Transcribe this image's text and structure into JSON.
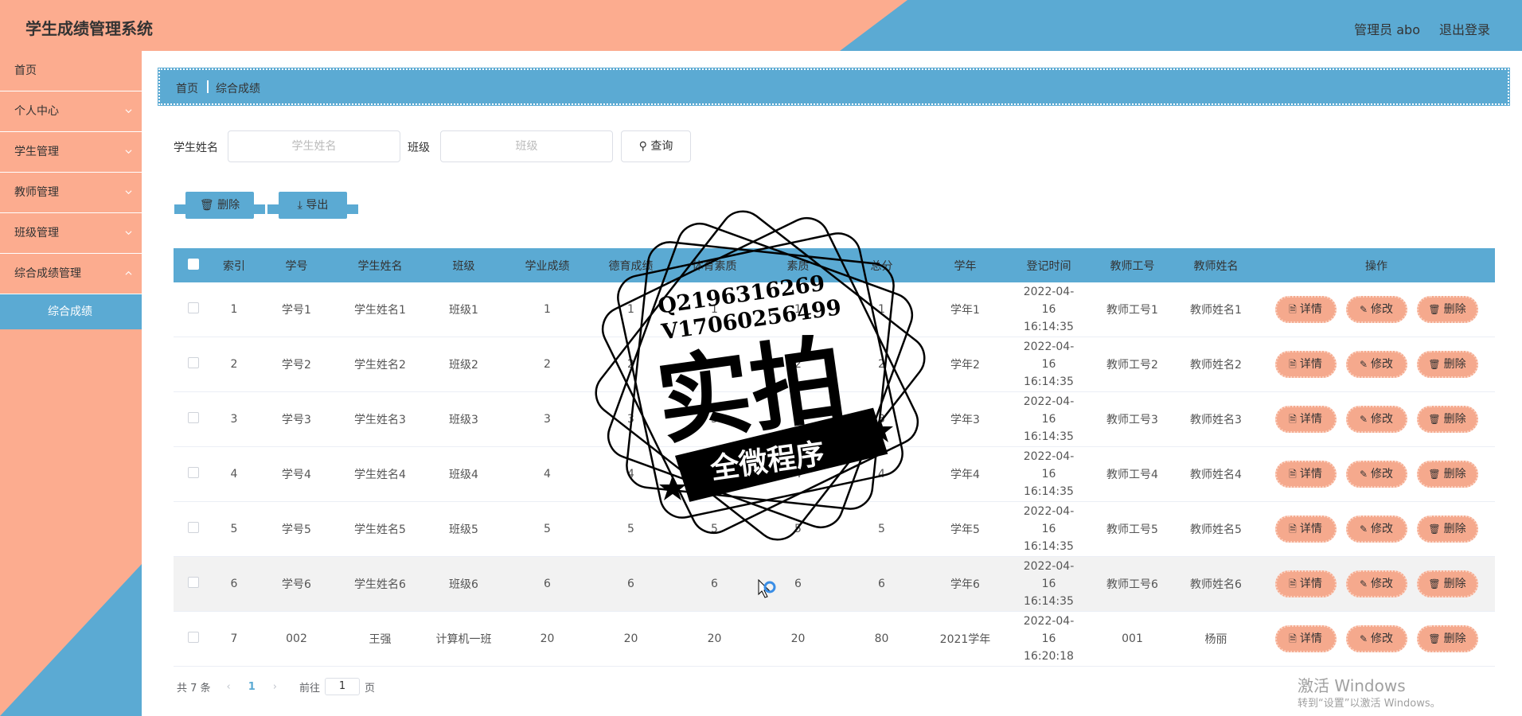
{
  "header": {
    "title": "学生成绩管理系统",
    "user": "管理员 abo",
    "logout": "退出登录"
  },
  "sidebar": {
    "items": [
      {
        "label": "首页",
        "expandable": false
      },
      {
        "label": "个人中心",
        "expandable": true
      },
      {
        "label": "学生管理",
        "expandable": true
      },
      {
        "label": "教师管理",
        "expandable": true
      },
      {
        "label": "班级管理",
        "expandable": true
      },
      {
        "label": "综合成绩管理",
        "expandable": true
      }
    ],
    "active_sub": "综合成绩"
  },
  "breadcrumb": {
    "home": "首页",
    "current": "综合成绩"
  },
  "search": {
    "name_label": "学生姓名",
    "name_placeholder": "学生姓名",
    "class_label": "班级",
    "class_placeholder": "班级",
    "button": "查询"
  },
  "actions": {
    "delete": "删除",
    "export": "导出"
  },
  "table": {
    "headers": [
      "索引",
      "学号",
      "学生姓名",
      "班级",
      "学业成绩",
      "德育成绩",
      "体育素质",
      "素质",
      "总分",
      "学年",
      "登记时间",
      "教师工号",
      "教师姓名",
      "操作"
    ],
    "rows": [
      [
        "1",
        "学号1",
        "学生姓名1",
        "班级1",
        "1",
        "1",
        "1",
        "1",
        "1",
        "学年1",
        "2022-04-16 16:14:35",
        "教师工号1",
        "教师姓名1"
      ],
      [
        "2",
        "学号2",
        "学生姓名2",
        "班级2",
        "2",
        "2",
        "2",
        "2",
        "2",
        "学年2",
        "2022-04-16 16:14:35",
        "教师工号2",
        "教师姓名2"
      ],
      [
        "3",
        "学号3",
        "学生姓名3",
        "班级3",
        "3",
        "3",
        "3",
        "3",
        "3",
        "学年3",
        "2022-04-16 16:14:35",
        "教师工号3",
        "教师姓名3"
      ],
      [
        "4",
        "学号4",
        "学生姓名4",
        "班级4",
        "4",
        "4",
        "4",
        "4",
        "4",
        "学年4",
        "2022-04-16 16:14:35",
        "教师工号4",
        "教师姓名4"
      ],
      [
        "5",
        "学号5",
        "学生姓名5",
        "班级5",
        "5",
        "5",
        "5",
        "5",
        "5",
        "学年5",
        "2022-04-16 16:14:35",
        "教师工号5",
        "教师姓名5"
      ],
      [
        "6",
        "学号6",
        "学生姓名6",
        "班级6",
        "6",
        "6",
        "6",
        "6",
        "6",
        "学年6",
        "2022-04-16 16:14:35",
        "教师工号6",
        "教师姓名6"
      ],
      [
        "7",
        "002",
        "王强",
        "计算机一班",
        "20",
        "20",
        "20",
        "20",
        "80",
        "2021学年",
        "2022-04-16 16:20:18",
        "001",
        "杨丽"
      ]
    ],
    "ops": [
      "详情",
      "修改",
      "删除"
    ],
    "highlight_row": 5
  },
  "pagination": {
    "total": "共 7 条",
    "current": "1",
    "goto": "前往",
    "page_input": "1",
    "unit": "页"
  },
  "windows": {
    "title": "激活 Windows",
    "sub": "转到“设置”以激活 Windows。"
  },
  "stamp": {
    "line1": "Q2196316269",
    "line2": "V17060256499",
    "main": "实拍",
    "banner": "全微程序"
  },
  "colors": {
    "salmon": "#fcac8f",
    "blue": "#5baad3",
    "op_button": "#f5a98d"
  }
}
